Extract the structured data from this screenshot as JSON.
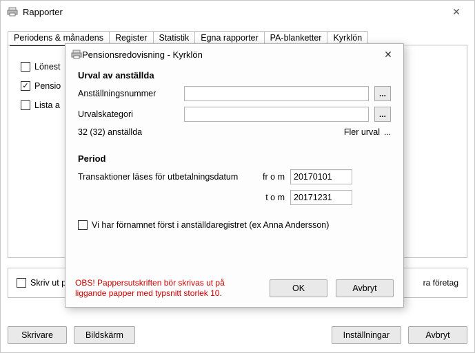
{
  "window": {
    "title": "Rapporter"
  },
  "tabs": {
    "items": [
      "Periodens & månadens",
      "Register",
      "Statistik",
      "Egna rapporter",
      "PA-blanketter",
      "Kyrklön"
    ]
  },
  "panel_checks": {
    "lonest": "Lönest",
    "pensio": "Pensio",
    "lista": "Lista a"
  },
  "print_row": {
    "label": "Skriv ut p",
    "tail": "ra företag"
  },
  "buttons": {
    "skrivare": "Skrivare",
    "bildskarm": "Bildskärm",
    "installningar": "Inställningar",
    "avbryt": "Avbryt"
  },
  "modal": {
    "title": "Pensionsredovisning - Kyrklön",
    "section_urval": "Urval av anställda",
    "anst_nr_label": "Anställningsnummer",
    "anst_nr_value": "",
    "urvalskategori_label": "Urvalskategori",
    "urvalskategori_value": "",
    "count_label": "32 (32) anställda",
    "fler_urval": "Fler urval",
    "section_period": "Period",
    "trans_label": "Transaktioner läses för utbetalningsdatum",
    "from_label": "fr o m",
    "from_value": "20170101",
    "to_label": "t o m",
    "to_value": "20171231",
    "firstname_check": "Vi har förnamnet först i anställdaregistret (ex Anna Andersson)",
    "warn_line1": "OBS! Pappersutskriften bör skrivas ut på",
    "warn_line2": "liggande papper med typsnitt storlek 10.",
    "ok": "OK",
    "cancel": "Avbryt",
    "ellipsis": "..."
  }
}
